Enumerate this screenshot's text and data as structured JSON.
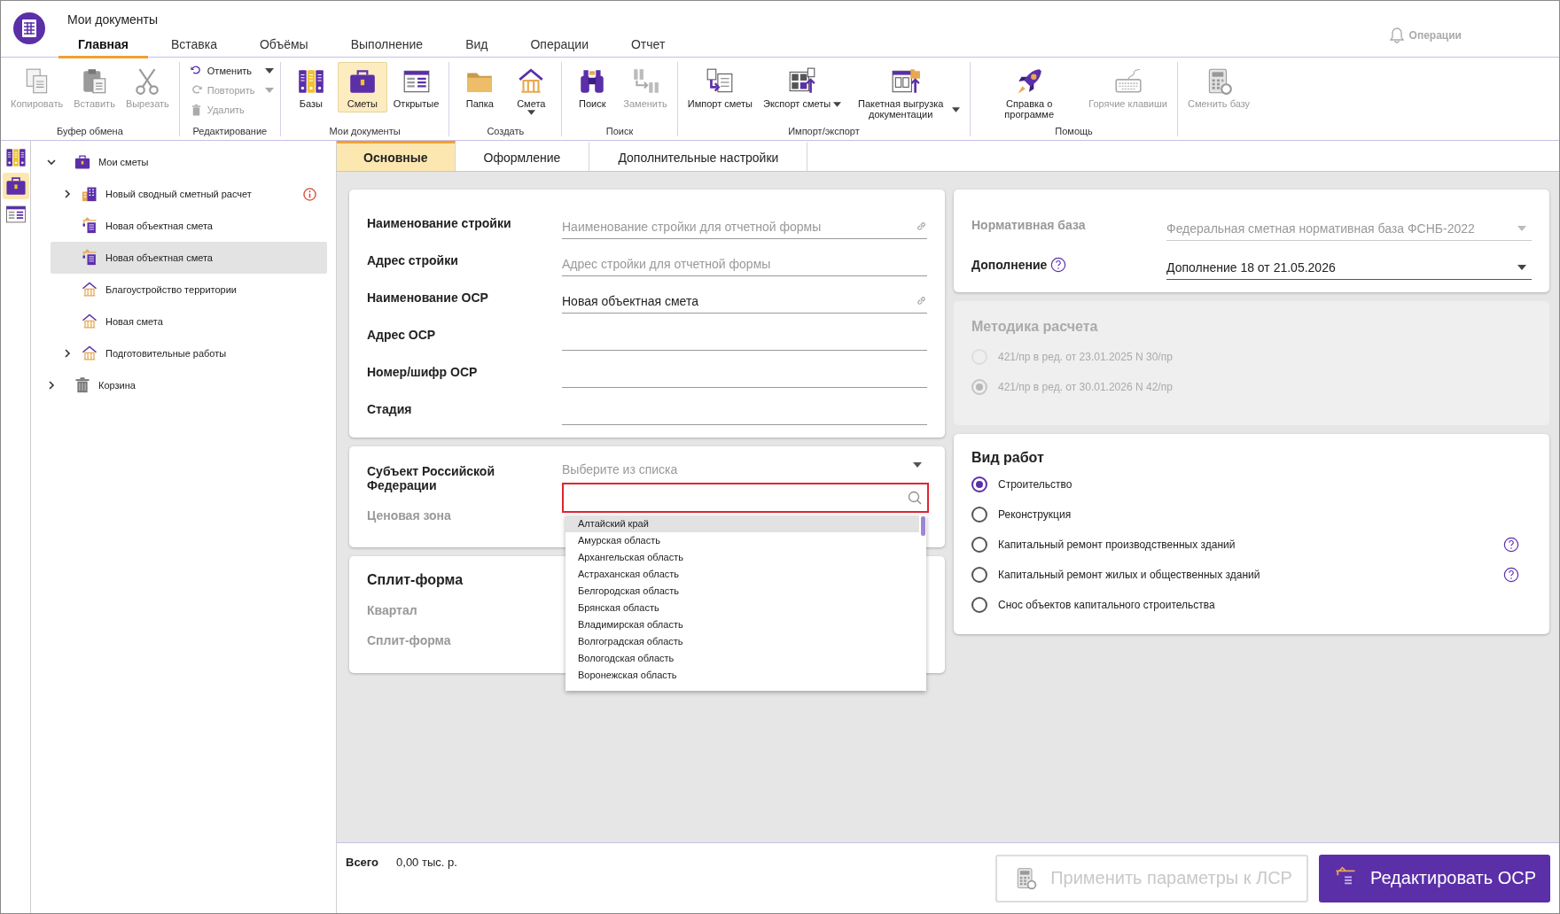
{
  "app": {
    "title": "Мои документы",
    "notifications": "Операции"
  },
  "menu_tabs": [
    {
      "label": "Главная",
      "selected": true
    },
    {
      "label": "Вставка",
      "selected": false
    },
    {
      "label": "Объёмы",
      "selected": false
    },
    {
      "label": "Выполнение",
      "selected": false
    },
    {
      "label": "Вид",
      "selected": false
    },
    {
      "label": "Операции",
      "selected": false
    },
    {
      "label": "Отчет",
      "selected": false
    }
  ],
  "ribbon": [
    {
      "label": "Буфер обмена",
      "kind": "row",
      "buttons": [
        {
          "kind": "plain",
          "label": "Копировать",
          "disabled": true,
          "selected": false,
          "dropdown": false
        },
        {
          "kind": "plain",
          "label": "Вставить",
          "disabled": true,
          "selected": false,
          "dropdown": false
        },
        {
          "kind": "plain",
          "label": "Вырезать",
          "disabled": true,
          "selected": false,
          "dropdown": false
        }
      ]
    },
    {
      "label": "Редактирование",
      "kind": "stack",
      "buttons": [
        {
          "kind": "plain",
          "label": "Отменить",
          "disabled": false,
          "selected": false,
          "dropdown": true
        },
        {
          "kind": "plain",
          "label": "Повторить",
          "disabled": true,
          "selected": false,
          "dropdown": true
        },
        {
          "kind": "plain",
          "label": "Удалить",
          "disabled": true,
          "selected": false,
          "dropdown": false
        }
      ]
    },
    {
      "label": "Мои документы",
      "kind": "row",
      "buttons": [
        {
          "kind": "plain",
          "label": "Базы",
          "disabled": false,
          "selected": false,
          "dropdown": false
        },
        {
          "kind": "plain",
          "label": "Сметы",
          "disabled": false,
          "selected": true,
          "dropdown": false
        },
        {
          "kind": "plain",
          "label": "Открытые",
          "disabled": false,
          "selected": false,
          "dropdown": false
        }
      ]
    },
    {
      "label": "Создать",
      "kind": "row",
      "buttons": [
        {
          "kind": "plain",
          "label": "Папка",
          "disabled": false,
          "selected": false,
          "dropdown": false
        },
        {
          "kind": "menu",
          "label": "Смета",
          "disabled": false,
          "selected": false,
          "dropdown": true
        }
      ]
    },
    {
      "label": "Поиск",
      "kind": "row",
      "buttons": [
        {
          "kind": "plain",
          "label": "Поиск",
          "disabled": false,
          "selected": false,
          "dropdown": false
        },
        {
          "kind": "plain",
          "label": "Заменить",
          "disabled": true,
          "selected": false,
          "dropdown": false
        }
      ]
    },
    {
      "label": "Импорт/экспорт",
      "kind": "row",
      "buttons": [
        {
          "kind": "plain",
          "label": "Импорт сметы",
          "disabled": false,
          "selected": false,
          "dropdown": false
        },
        {
          "kind": "plain",
          "label": "Экспорт сметы",
          "disabled": false,
          "selected": false,
          "dropdown": true
        },
        {
          "kind": "plain",
          "label": "Пакетная выгрузка документации",
          "disabled": false,
          "selected": false,
          "dropdown": true
        }
      ]
    },
    {
      "label": "Помощь",
      "kind": "row",
      "buttons": [
        {
          "kind": "plain",
          "label": "Справка о программе",
          "disabled": false,
          "selected": false,
          "dropdown": false
        },
        {
          "kind": "plain",
          "label": "Горячие клавиши",
          "disabled": true,
          "selected": false,
          "dropdown": false
        }
      ]
    },
    {
      "kind": "row",
      "buttons": [
        {
          "kind": "plain",
          "label": "Сменить базу",
          "disabled": true,
          "selected": false,
          "dropdown": false
        }
      ]
    }
  ],
  "side_icons": [
    {
      "selected": false
    },
    {
      "selected": true
    },
    {
      "selected": false
    }
  ],
  "tree": [
    {
      "label": "Мои сметы",
      "kind": "folder",
      "expandable": true,
      "expanded": true,
      "selected": false,
      "warning": false,
      "children": [
        {
          "label": "Новый сводный сметный расчет",
          "kind": "summary",
          "expandable": true,
          "expanded": false,
          "selected": false,
          "warning": true
        },
        {
          "label": "Новая объектная смета",
          "kind": "object",
          "expandable": false,
          "expanded": false,
          "selected": false,
          "warning": false
        },
        {
          "label": "Новая объектная смета",
          "kind": "object",
          "expandable": false,
          "expanded": false,
          "selected": true,
          "warning": false
        },
        {
          "label": "Благоустройство территории",
          "kind": "estimate",
          "expandable": false,
          "expanded": false,
          "selected": false,
          "warning": false
        },
        {
          "label": "Новая смета",
          "kind": "estimate",
          "expandable": false,
          "expanded": false,
          "selected": false,
          "warning": false
        },
        {
          "label": "Подготовительные работы",
          "kind": "estimate",
          "expandable": true,
          "expanded": false,
          "selected": false,
          "warning": false
        }
      ]
    },
    {
      "label": "Корзина",
      "kind": "recycle",
      "expandable": true,
      "expanded": false,
      "selected": false,
      "warning": false
    }
  ],
  "form_tabs": [
    {
      "label": "Основные",
      "selected": true
    },
    {
      "label": "Оформление",
      "selected": false
    },
    {
      "label": "Дополнительные настройки",
      "selected": false
    }
  ],
  "general_fields": [
    {
      "label": "Наименование стройки",
      "placeholder": "Наименование стройки для отчетной формы",
      "link": true
    },
    {
      "label": "Адрес стройки",
      "placeholder": "Адрес стройки для отчетной формы",
      "link": false
    },
    {
      "label": "Наименование ОСР",
      "value": "Новая объектная смета",
      "link": true
    },
    {
      "label": "Адрес ОСР",
      "link": false
    },
    {
      "label": "Номер/шифр ОСР",
      "link": false
    },
    {
      "label": "Стадия",
      "link": false
    }
  ],
  "region": {
    "label": "Субъект Российской Федерации",
    "placeholder": "Выберите из списка",
    "price_zone": "Ценовая зона",
    "options": [
      {
        "label": "Алтайский край",
        "selected": true
      },
      {
        "label": "Амурская область",
        "selected": false
      },
      {
        "label": "Архангельская область",
        "selected": false
      },
      {
        "label": "Астраханская область",
        "selected": false
      },
      {
        "label": "Белгородская область",
        "selected": false
      },
      {
        "label": "Брянская область",
        "selected": false
      },
      {
        "label": "Владимирская область",
        "selected": false
      },
      {
        "label": "Волгоградская область",
        "selected": false
      },
      {
        "label": "Вологодская область",
        "selected": false
      },
      {
        "label": "Воронежская область",
        "selected": false
      }
    ]
  },
  "split": {
    "title": "Сплит-форма",
    "fields": [
      "Квартал",
      "Сплит-форма"
    ]
  },
  "norm": {
    "base_label": "Нормативная база",
    "base_value": "Федеральная сметная нормативная база ФСНБ-2022",
    "base_disabled": true,
    "addition_label": "Дополнение",
    "addition_value": "Дополнение 18 от 21.05.2026"
  },
  "method": {
    "title": "Методика расчета",
    "disabled": true,
    "options": [
      {
        "label": "421/пр в ред. от 23.01.2025 N 30/пр",
        "selected": false
      },
      {
        "label": "421/пр в ред. от 30.01.2026 N 42/пр",
        "selected": true
      }
    ]
  },
  "work_type": {
    "title": "Вид работ",
    "options": [
      {
        "label": "Строительство",
        "selected": true,
        "help": false
      },
      {
        "label": "Реконструкция",
        "selected": false,
        "help": false
      },
      {
        "label": "Капитальный ремонт производственных зданий",
        "selected": false,
        "help": true
      },
      {
        "label": "Капитальный ремонт жилых и общественных зданий",
        "selected": false,
        "help": true
      },
      {
        "label": "Снос объектов капитального строительства",
        "selected": false,
        "help": false
      }
    ]
  },
  "footer": {
    "total_label": "Всего",
    "total_value": "0,00 тыс. р.",
    "buttons": [
      {
        "label": "Применить параметры к ЛСР",
        "disabled": true
      },
      {
        "label": "Редактировать ОСР",
        "disabled": false
      }
    ]
  }
}
